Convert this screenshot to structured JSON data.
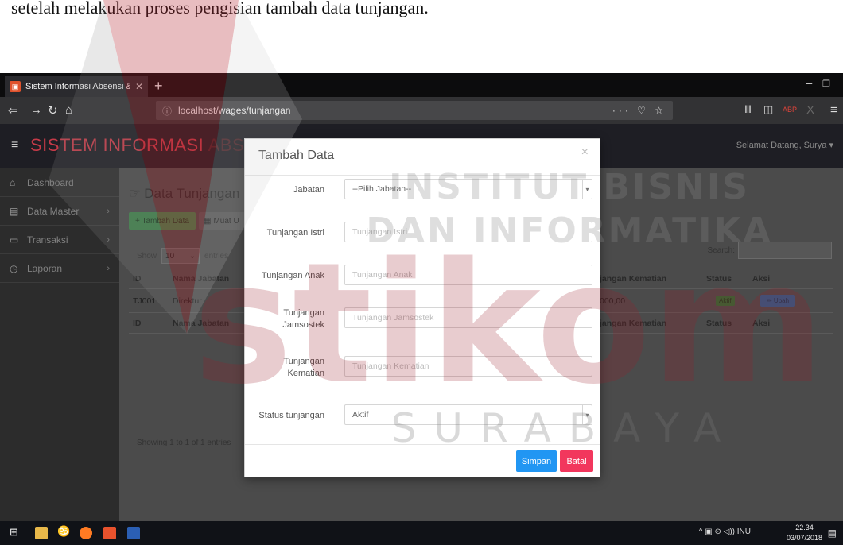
{
  "caption": "setelah melakukan proses pengisian tambah data tunjangan.",
  "browser": {
    "tab_title": "Sistem Informasi Absensi & Pe",
    "url": "localhost/wages/tunjangan"
  },
  "app": {
    "brand_bright": "SISTEM INFORMASI",
    "brand_dim": "ABSENSI & PENGGAJIAN",
    "greeting": "Selamat Datang, Surya ▾"
  },
  "sidebar": {
    "items": [
      {
        "label": "Dashboard",
        "icon": "home-icon"
      },
      {
        "label": "Data Master",
        "icon": "document-icon"
      },
      {
        "label": "Transaksi",
        "icon": "monitor-icon"
      },
      {
        "label": "Laporan",
        "icon": "clock-icon"
      }
    ]
  },
  "page": {
    "title": "Data Tunjangan",
    "add_button": "+ Tambah Data",
    "import_button": "Muat U",
    "show_label": "Show",
    "show_value": "10",
    "entries_label": "entries",
    "search_label": "Search:",
    "showing": "Showing 1 to 1 of 1 entries"
  },
  "table": {
    "headers": [
      "ID",
      "Nama Jabatan",
      "jangan Kematian",
      "Status",
      "Aksi"
    ],
    "rows": [
      {
        "id": "TJ001",
        "nama": "Direktur",
        "kematian": "000,00",
        "status": "Aktif",
        "aksi": "✏ Ubah"
      }
    ],
    "footer": [
      "ID",
      "Nama Jabatan",
      "jangan Kematian",
      "Status",
      "Aksi"
    ]
  },
  "modal": {
    "title": "Tambah Data",
    "close": "×",
    "fields": [
      {
        "label": "Jabatan",
        "value": "--Pilih Jabatan--",
        "kind": "select"
      },
      {
        "label": "Tunjangan Istri",
        "placeholder": "Tunjangan Istri",
        "kind": "input"
      },
      {
        "label": "Tunjangan Anak",
        "placeholder": "Tunjangan Anak",
        "kind": "input"
      },
      {
        "label": "Tunjangan Jamsostek",
        "placeholder": "Tunjangan Jamsostek",
        "kind": "input"
      },
      {
        "label": "Tunjangan Kematian",
        "placeholder": "Tunjangan Kematian",
        "kind": "input"
      },
      {
        "label": "Status tunjangan",
        "value": "Aktif",
        "kind": "select"
      }
    ],
    "save": "Simpan",
    "cancel": "Batal"
  },
  "taskbar": {
    "tray": "^ ▣ ⊙ ◁)) INU",
    "time": "22.34",
    "date": "03/07/2018"
  },
  "watermark": {
    "line1": "INSTITUT BISNIS",
    "line2": "DAN INFORMATIKA",
    "logo": "stikom",
    "line3": "SURABAYA"
  },
  "colors": {
    "brand_red": "#c53a48",
    "save_blue": "#2196f3",
    "cancel_pink": "#f2375d"
  }
}
